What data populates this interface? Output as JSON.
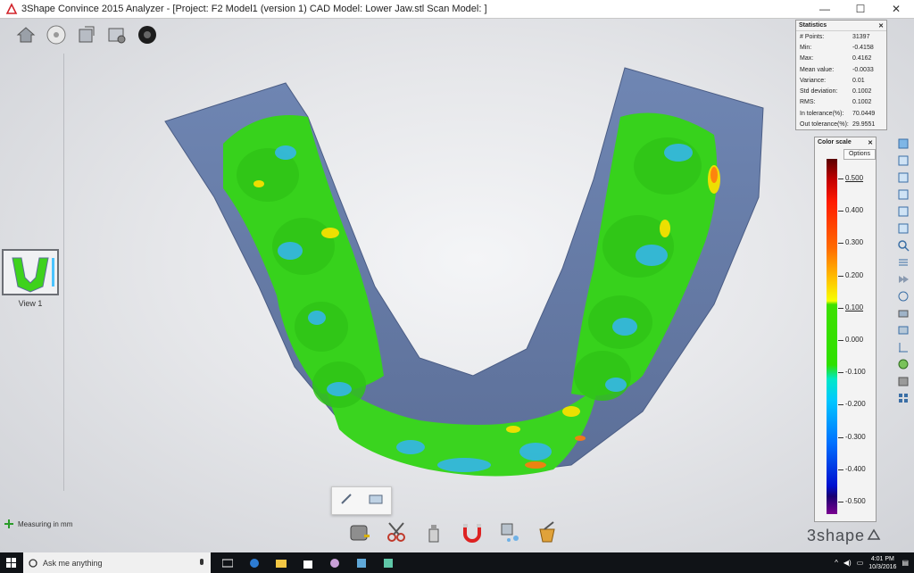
{
  "window": {
    "title": "3Shape Convince 2015 Analyzer - [Project: F2 Model1 (version 1) CAD Model: Lower Jaw.stl Scan Model: ]",
    "minimize": "—",
    "maximize": "☐",
    "close": "✕"
  },
  "view_thumbnail": {
    "label": "View 1"
  },
  "statistics": {
    "title": "Statistics",
    "close": "✕",
    "rows": [
      {
        "label": "# Points:",
        "value": "31397"
      },
      {
        "label": "Min:",
        "value": "-0.4158"
      },
      {
        "label": "Max:",
        "value": "0.4162"
      },
      {
        "label": "Mean value:",
        "value": "-0.0033"
      },
      {
        "label": "Variance:",
        "value": "0.01"
      },
      {
        "label": "Std deviation:",
        "value": "0.1002"
      },
      {
        "label": "RMS:",
        "value": "0.1002"
      },
      {
        "label": "In tolerance(%):",
        "value": "70.0449"
      },
      {
        "label": "Out tolerance(%):",
        "value": "29.9551"
      }
    ]
  },
  "color_scale": {
    "title": "Color scale",
    "close": "✕",
    "options_label": "Options",
    "labels": [
      "0.500",
      "0.400",
      "0.300",
      "0.200",
      "0.100",
      "0.000",
      "-0.100",
      "-0.200",
      "-0.300",
      "-0.400",
      "-0.500"
    ]
  },
  "status": {
    "measuring": "Measuring in mm"
  },
  "brand": "3shape",
  "taskbar": {
    "search_placeholder": "Ask me anything",
    "time": "4:01 PM",
    "date": "10/3/2016"
  }
}
